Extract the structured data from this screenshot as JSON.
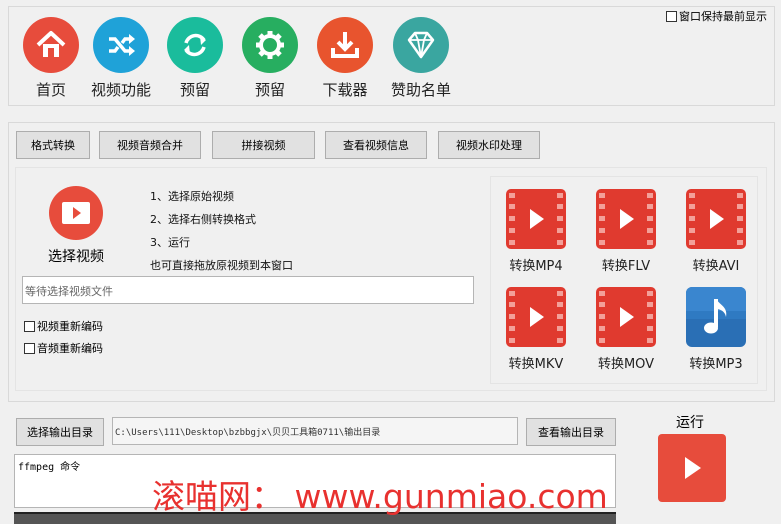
{
  "window": {
    "keep_on_top_label": "窗口保持最前显示"
  },
  "nav": {
    "items": [
      {
        "label": "首页",
        "icon": "home-icon",
        "color": "#e74c3c"
      },
      {
        "label": "视频功能",
        "icon": "shuffle-icon",
        "color": "#1fa2d8"
      },
      {
        "label": "预留",
        "icon": "refresh-icon",
        "color": "#1abc9c"
      },
      {
        "label": "预留",
        "icon": "gear-icon",
        "color": "#27ae60"
      },
      {
        "label": "下载器",
        "icon": "download-icon",
        "color": "#e8542e"
      },
      {
        "label": "赞助名单",
        "icon": "diamond-icon",
        "color": "#3aa6a0"
      }
    ]
  },
  "tabs": [
    "格式转换",
    "视频音频合并",
    "拼接视频",
    "查看视频信息",
    "视频水印处理"
  ],
  "select_video": {
    "label": "选择视频",
    "instructions": [
      "1、选择原始视频",
      "2、选择右侧转换格式",
      "3、运行",
      "也可直接拖放原视频到本窗口"
    ],
    "placeholder": "等待选择视频文件",
    "options": [
      "视频重新编码",
      "音频重新编码"
    ]
  },
  "converters": [
    {
      "label": "转换MP4",
      "icon": "film-icon"
    },
    {
      "label": "转换FLV",
      "icon": "film-icon"
    },
    {
      "label": "转换AVI",
      "icon": "film-icon"
    },
    {
      "label": "转换MKV",
      "icon": "film-icon"
    },
    {
      "label": "转换MOV",
      "icon": "film-icon"
    },
    {
      "label": "转换MP3",
      "icon": "music-note-icon"
    }
  ],
  "output": {
    "select_button": "选择输出目录",
    "path": "C:\\Users\\111\\Desktop\\bzbbgjx\\贝贝工具箱0711\\输出目录",
    "view_button": "查看输出目录",
    "run_label": "运行",
    "command_text": "ffmpeg 命令"
  },
  "watermark": "滚喵网： www.gunmiao.com",
  "colors": {
    "accent_red": "#e74c3c",
    "music_blue": "#2a6fb5"
  }
}
